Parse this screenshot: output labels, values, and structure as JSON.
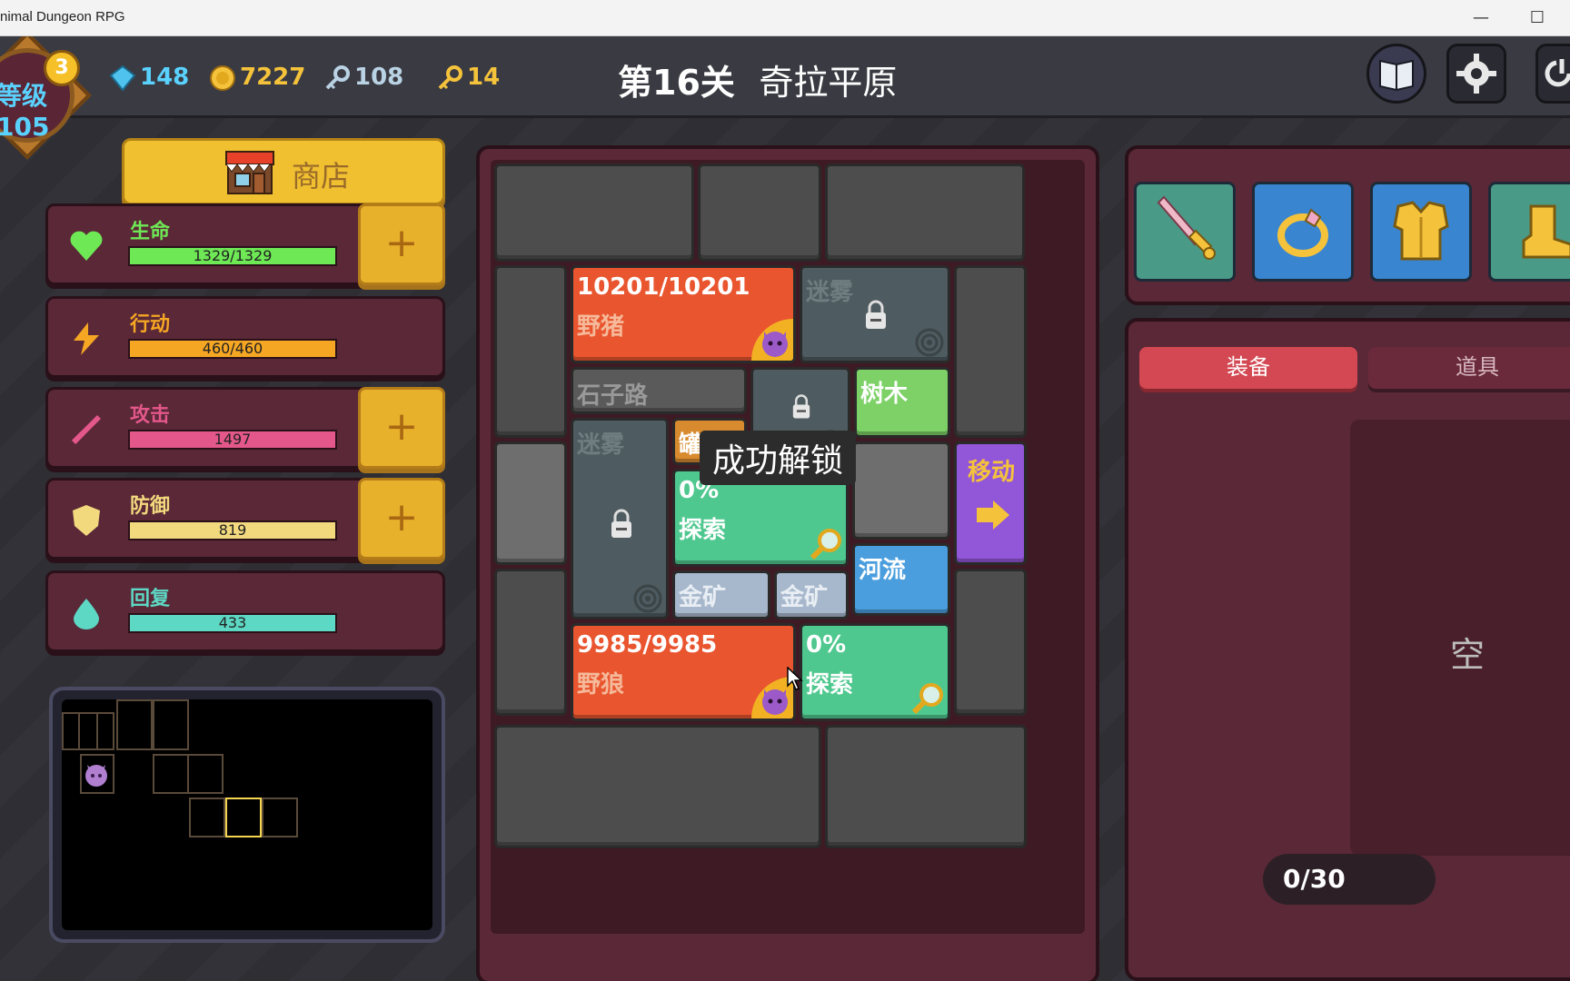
{
  "window": {
    "title": "nimal Dungeon RPG",
    "minimize": "—",
    "maximize": "☐"
  },
  "player": {
    "level_label": "等级",
    "level_value": "105",
    "badge_number": "3"
  },
  "resources": {
    "gems": "148",
    "coins": "7227",
    "silver_keys": "108",
    "gold_keys": "14"
  },
  "stage": {
    "title": "第16关",
    "name": "奇拉平原"
  },
  "shop": {
    "label": "商店"
  },
  "stats": {
    "hp": {
      "name": "生命",
      "value": "1329/1329",
      "color": "#6ee855",
      "fill": 1.0
    },
    "action": {
      "name": "行动",
      "value": "460/460",
      "color": "#f5a623",
      "fill": 1.0
    },
    "attack": {
      "name": "攻击",
      "value": "1497",
      "color": "#e4578a"
    },
    "defense": {
      "name": "防御",
      "value": "819",
      "color": "#f3d97e"
    },
    "recover": {
      "name": "回复",
      "value": "433",
      "color": "#5dd8c4"
    },
    "plus": "+"
  },
  "board": {
    "enemy1": {
      "hp": "10201/10201",
      "name": "野猪"
    },
    "fog1": {
      "label": "迷雾"
    },
    "road": {
      "label": "石子路"
    },
    "tree": {
      "label": "树木"
    },
    "fog2": {
      "label": "迷雾"
    },
    "jar": {
      "label": "罐子"
    },
    "explore1": {
      "pct": "0%",
      "label": "探索"
    },
    "move": {
      "label": "移动"
    },
    "river": {
      "label": "河流"
    },
    "ore1": {
      "label": "金矿"
    },
    "ore2": {
      "label": "金矿"
    },
    "enemy2": {
      "hp": "9985/9985",
      "name": "野狼"
    },
    "explore2": {
      "pct": "0%",
      "label": "探索"
    },
    "toast": "成功解锁"
  },
  "bag": {
    "tab_equip": "装备",
    "tab_items": "道具",
    "empty_text": "空",
    "count": "0/30"
  }
}
